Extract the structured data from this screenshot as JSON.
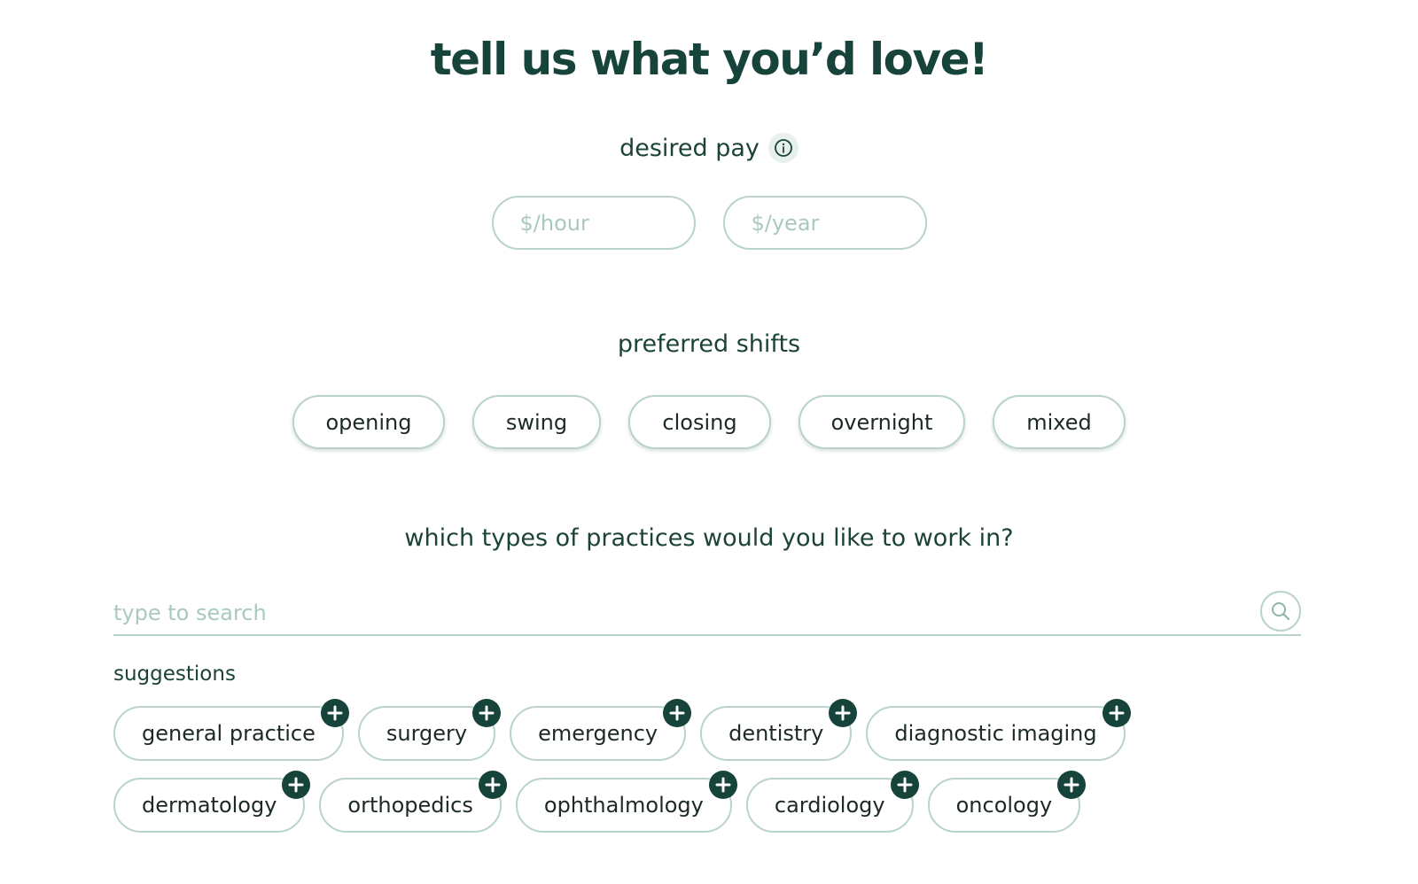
{
  "title": "tell us what you’d love!",
  "pay": {
    "label": "desired pay",
    "info_icon": "info-icon",
    "hour_placeholder": "$/hour",
    "year_placeholder": "$/year"
  },
  "shifts": {
    "label": "preferred shifts",
    "options": [
      "opening",
      "swing",
      "closing",
      "overnight",
      "mixed"
    ]
  },
  "practices": {
    "label": "which types of practices would you like to work in?",
    "search_placeholder": "type to search",
    "search_icon": "search-icon",
    "suggestions_label": "suggestions",
    "suggestions_row1": [
      "general practice",
      "surgery",
      "emergency",
      "dentistry",
      "diagnostic imaging"
    ],
    "suggestions_row2": [
      "dermatology",
      "orthopedics",
      "ophthalmology",
      "cardiology",
      "oncology"
    ],
    "add_icon": "plus-icon"
  },
  "colors": {
    "brand_dark": "#17443a",
    "border": "#b9d3cc",
    "placeholder": "#a9c9c0",
    "info_bg": "#e7f0ed"
  }
}
